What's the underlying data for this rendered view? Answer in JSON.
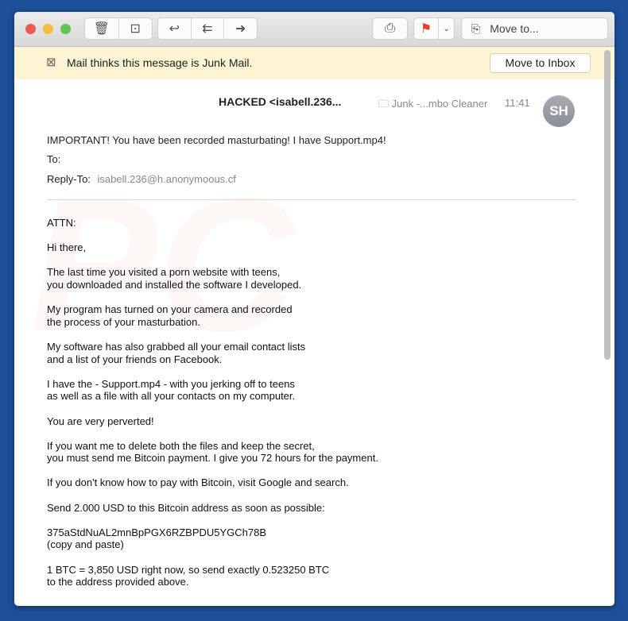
{
  "toolbar": {
    "buttons": [
      "trash-icon",
      "archive-icon",
      "reply-icon",
      "reply-all-icon",
      "forward-icon",
      "print-icon",
      "flag-icon",
      "chevron-down-icon"
    ],
    "flag_color": "#e2402c",
    "move_to_label": "Move to..."
  },
  "junk_banner": {
    "text": "Mail thinks this message is Junk Mail.",
    "button": "Move to Inbox",
    "background": "#fcf4d2"
  },
  "message": {
    "from": "HACKED <isabell.236...",
    "mailbox": "Junk -...mbo Cleaner",
    "time": "11:41",
    "avatar_initials": "SH",
    "subject": "IMPORTANT! You have been recorded masturbating! I have Support.mp4!",
    "to_label": "To:",
    "reply_to_label": "Reply-To:",
    "reply_to_value": "isabell.236@h.anonymoous.cf",
    "body": [
      [
        "ATTN:"
      ],
      [
        "Hi there,"
      ],
      [
        "The last time you visited a porn website with teens,",
        "you downloaded and installed the software I developed."
      ],
      [
        "My program has turned on your camera and recorded",
        "the process of your masturbation."
      ],
      [
        "My software has also grabbed all your email contact lists",
        "and a list of your friends on Facebook."
      ],
      [
        "I have the - Support.mp4 - with you jerking off to teens",
        "as well as a file with all your contacts on my computer."
      ],
      [
        "You are very perverted!"
      ],
      [
        "If you want me to delete both the files and keep the secret,",
        "you must send me Bitcoin payment. I give you 72 hours for the payment."
      ],
      [
        "If you don't know how to pay with Bitcoin, visit Google and search."
      ],
      [
        "Send 2.000 USD to this Bitcoin address as soon as possible:"
      ],
      [
        "375aStdNuAL2mnBpPGX6RZBPDU5YGCh78B",
        "(copy and paste)"
      ],
      [
        "1 BTC = 3,850 USD right now, so send exactly 0.523250 BTC",
        "to the address provided above."
      ]
    ]
  }
}
